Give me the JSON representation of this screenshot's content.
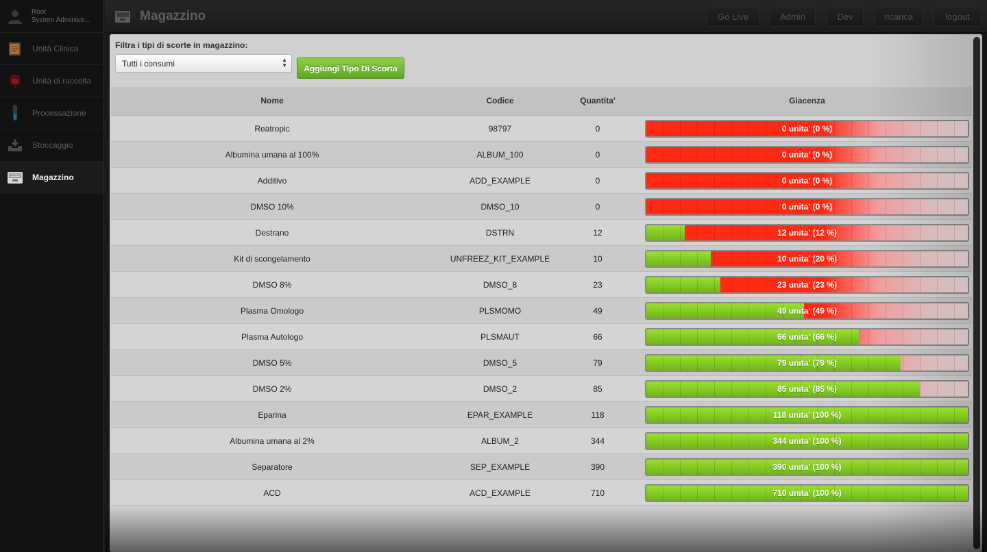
{
  "user": {
    "name": "Root",
    "role": "System Administr..."
  },
  "sidebar": {
    "items": [
      {
        "label": "Unità Clinica",
        "icon": "clinical-folder-icon",
        "active": false
      },
      {
        "label": "Unità di raccolta",
        "icon": "blood-bag-icon",
        "active": false
      },
      {
        "label": "Processazione",
        "icon": "test-tube-icon",
        "active": false
      },
      {
        "label": "Stoccaggio",
        "icon": "storage-tray-icon",
        "active": false
      },
      {
        "label": "Magazzino",
        "icon": "warehouse-drawer-icon",
        "active": true
      }
    ]
  },
  "header": {
    "title": "Magazzino",
    "buttons": [
      "Go Live",
      "Admin",
      "Dev",
      "ricarica",
      "logout"
    ]
  },
  "filter": {
    "label": "Filtra i tipi di scorte in magazzino:",
    "selected": "Tutti i consumi",
    "add_button": "Aggiungi Tipo Di Scorta"
  },
  "table": {
    "headers": {
      "nome": "Nome",
      "codice": "Codice",
      "quantita": "Quantita'",
      "giacenza": "Giacenza"
    },
    "rows": [
      {
        "nome": "Reatropic",
        "codice": "98797",
        "quantita": "0",
        "percent": 0,
        "giacenza": "0 unita' (0 %)"
      },
      {
        "nome": "Albumina umana al 100%",
        "codice": "ALBUM_100",
        "quantita": "0",
        "percent": 0,
        "giacenza": "0 unita' (0 %)"
      },
      {
        "nome": "Additivo",
        "codice": "ADD_EXAMPLE",
        "quantita": "0",
        "percent": 0,
        "giacenza": "0 unita' (0 %)"
      },
      {
        "nome": "DMSO 10%",
        "codice": "DMSO_10",
        "quantita": "0",
        "percent": 0,
        "giacenza": "0 unita' (0 %)"
      },
      {
        "nome": "Destrano",
        "codice": "DSTRN",
        "quantita": "12",
        "percent": 12,
        "giacenza": "12 unita' (12 %)"
      },
      {
        "nome": "Kit di scongelamento",
        "codice": "UNFREEZ_KIT_EXAMPLE",
        "quantita": "10",
        "percent": 20,
        "giacenza": "10 unita' (20 %)"
      },
      {
        "nome": "DMSO 8%",
        "codice": "DMSO_8",
        "quantita": "23",
        "percent": 23,
        "giacenza": "23 unita' (23 %)"
      },
      {
        "nome": "Plasma Omologo",
        "codice": "PLSMOMO",
        "quantita": "49",
        "percent": 49,
        "giacenza": "49 unita' (49 %)"
      },
      {
        "nome": "Plasma Autologo",
        "codice": "PLSMAUT",
        "quantita": "66",
        "percent": 66,
        "giacenza": "66 unita' (66 %)"
      },
      {
        "nome": "DMSO 5%",
        "codice": "DMSO_5",
        "quantita": "79",
        "percent": 79,
        "giacenza": "79 unita' (79 %)"
      },
      {
        "nome": "DMSO 2%",
        "codice": "DMSO_2",
        "quantita": "85",
        "percent": 85,
        "giacenza": "85 unita' (85 %)"
      },
      {
        "nome": "Eparina",
        "codice": "EPAR_EXAMPLE",
        "quantita": "118",
        "percent": 100,
        "giacenza": "118 unita' (100 %)"
      },
      {
        "nome": "Albumina umana al 2%",
        "codice": "ALBUM_2",
        "quantita": "344",
        "percent": 100,
        "giacenza": "344 unita' (100 %)"
      },
      {
        "nome": "Separatore",
        "codice": "SEP_EXAMPLE",
        "quantita": "390",
        "percent": 100,
        "giacenza": "390 unita' (100 %)"
      },
      {
        "nome": "ACD",
        "codice": "ACD_EXAMPLE",
        "quantita": "710",
        "percent": 100,
        "giacenza": "710 unita' (100 %)"
      }
    ]
  },
  "colors": {
    "accent_green": "#6fb51a",
    "stock_low_red": "#ff2a14",
    "panel_bg": "#cfcfcf",
    "sidebar_bg": "#121212"
  }
}
